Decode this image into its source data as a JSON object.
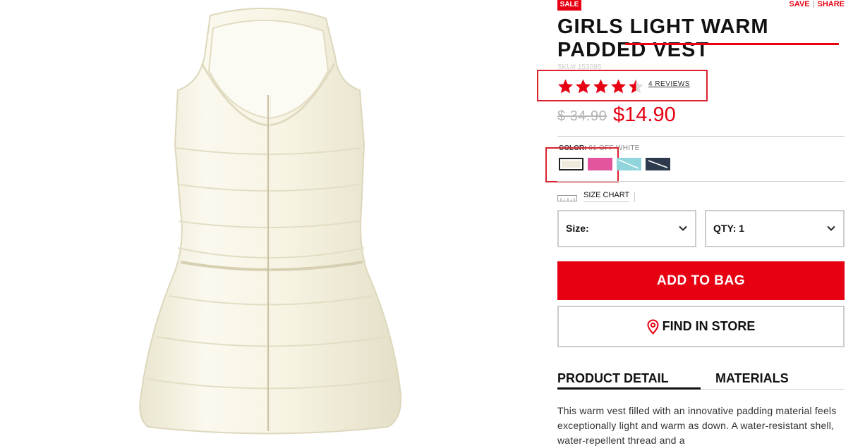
{
  "badge": {
    "sale": "SALE"
  },
  "top_links": {
    "save": "SAVE",
    "separator": "|",
    "share": "SHARE"
  },
  "product": {
    "title": "GIRLS LIGHT WARM PADDED VEST",
    "sku": "SKU# 153095",
    "image_icon": "padded-vest-image"
  },
  "rating": {
    "value": 4.5,
    "max": 5,
    "reviews_label": "4 REVIEWS"
  },
  "price": {
    "original": "$ 34.90",
    "sale": "$14.90"
  },
  "color": {
    "label": "COLOR:",
    "selected": "01 OFF WHITE",
    "swatches": [
      {
        "name": "off-white",
        "hex": "#eeebdc"
      },
      {
        "name": "pink",
        "hex": "#e2559e"
      },
      {
        "name": "light-blue",
        "hex": "#8fd5db"
      },
      {
        "name": "navy",
        "hex": "#2d3a4e"
      }
    ]
  },
  "size_chart": {
    "label": "SIZE CHART",
    "icon": "ruler-icon"
  },
  "selects": {
    "size_label": "Size:",
    "qty_label": "QTY: 1"
  },
  "buttons": {
    "add_to_bag": "ADD TO BAG",
    "find_in_store": "FIND IN STORE"
  },
  "tabs": {
    "product_detail": "PRODUCT DETAIL",
    "materials": "MATERIALS",
    "active": "product_detail"
  },
  "description": "This warm vest filled with an innovative padding material feels exceptionally light and warm as down. A water-resistant shell, water-repellent thread and a",
  "colors": {
    "accent": "#e60012",
    "annotation": "#d9232e",
    "border": "#cccccc"
  }
}
